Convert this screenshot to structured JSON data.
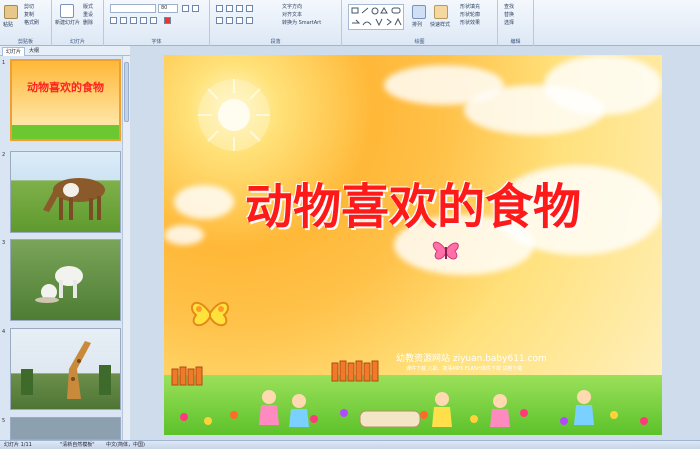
{
  "ribbon": {
    "groups": [
      {
        "label": "剪贴板",
        "buttons": [
          "粘贴"
        ],
        "small": [
          "剪切",
          "复制",
          "格式刷"
        ]
      },
      {
        "label": "幻灯片",
        "buttons": [
          "新建幻灯片"
        ],
        "small": [
          "版式",
          "重设",
          "删除"
        ]
      },
      {
        "label": "字体",
        "font_size": "80"
      },
      {
        "label": "段落",
        "small": [
          "文字方向",
          "对齐文本",
          "转换为 SmartArt"
        ]
      },
      {
        "label": "绘图",
        "buttons": [
          "排列",
          "快速样式"
        ],
        "small": [
          "形状填充",
          "形状轮廓",
          "形状效果"
        ]
      },
      {
        "label": "编辑",
        "small": [
          "查找",
          "替换",
          "选择"
        ]
      }
    ]
  },
  "leftpane": {
    "tabs": [
      "幻灯片",
      "大纲"
    ],
    "slides": [
      {
        "num": "1",
        "title": "动物喜欢的食物"
      },
      {
        "num": "2"
      },
      {
        "num": "3"
      },
      {
        "num": "4"
      },
      {
        "num": "5"
      }
    ]
  },
  "slide": {
    "title": "动物喜欢的食物",
    "watermark_line1": "幼教资源网站  ziyuan.baby611.com",
    "watermark_line2": "课件下载  儿歌、故事MP3  FLASH课件下载  试卷下载"
  },
  "status": {
    "page": "幻灯片 1/11",
    "theme": "\"清新自然模板\"",
    "lang": "中文(简体，中国)"
  },
  "colors": {
    "title": "#ff1a1a",
    "accent": "#f0a030"
  }
}
